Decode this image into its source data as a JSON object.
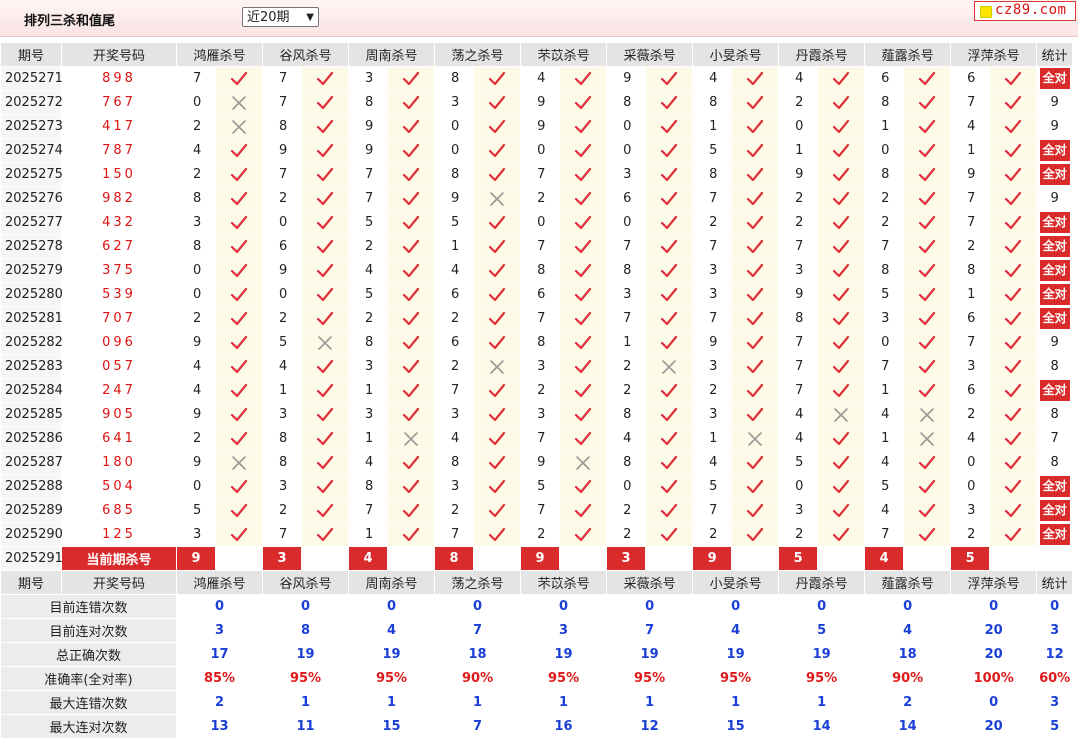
{
  "toolbar": {
    "title": "排列三杀和值尾",
    "period_select": "近20期",
    "logo_text": "cz89.com"
  },
  "colors": {
    "accent_red": "#d92b2b",
    "check_red": "#e0303a",
    "x_gray": "#999999",
    "stat_blue": "#1a3fd6"
  },
  "headers": {
    "period": "期号",
    "draw": "开奖号码",
    "experts": [
      "鸿雁杀号",
      "谷风杀号",
      "周南杀号",
      "荡之杀号",
      "芣苡杀号",
      "采薇杀号",
      "小旻杀号",
      "丹霞杀号",
      "薤露杀号",
      "浮萍杀号"
    ],
    "stat": "统计"
  },
  "rows": [
    {
      "period": "2025271",
      "draw": "898",
      "kills": [
        [
          7,
          1
        ],
        [
          7,
          1
        ],
        [
          3,
          1
        ],
        [
          8,
          1
        ],
        [
          4,
          1
        ],
        [
          9,
          1
        ],
        [
          4,
          1
        ],
        [
          4,
          1
        ],
        [
          6,
          1
        ],
        [
          6,
          1
        ]
      ],
      "stat": "全对"
    },
    {
      "period": "2025272",
      "draw": "767",
      "kills": [
        [
          0,
          0
        ],
        [
          7,
          1
        ],
        [
          8,
          1
        ],
        [
          3,
          1
        ],
        [
          9,
          1
        ],
        [
          8,
          1
        ],
        [
          8,
          1
        ],
        [
          2,
          1
        ],
        [
          8,
          1
        ],
        [
          7,
          1
        ]
      ],
      "stat": "9"
    },
    {
      "period": "2025273",
      "draw": "417",
      "kills": [
        [
          2,
          0
        ],
        [
          8,
          1
        ],
        [
          9,
          1
        ],
        [
          0,
          1
        ],
        [
          9,
          1
        ],
        [
          0,
          1
        ],
        [
          1,
          1
        ],
        [
          0,
          1
        ],
        [
          1,
          1
        ],
        [
          4,
          1
        ]
      ],
      "stat": "9"
    },
    {
      "period": "2025274",
      "draw": "787",
      "kills": [
        [
          4,
          1
        ],
        [
          9,
          1
        ],
        [
          9,
          1
        ],
        [
          0,
          1
        ],
        [
          0,
          1
        ],
        [
          0,
          1
        ],
        [
          5,
          1
        ],
        [
          1,
          1
        ],
        [
          0,
          1
        ],
        [
          1,
          1
        ]
      ],
      "stat": "全对"
    },
    {
      "period": "2025275",
      "draw": "150",
      "kills": [
        [
          2,
          1
        ],
        [
          7,
          1
        ],
        [
          7,
          1
        ],
        [
          8,
          1
        ],
        [
          7,
          1
        ],
        [
          3,
          1
        ],
        [
          8,
          1
        ],
        [
          9,
          1
        ],
        [
          8,
          1
        ],
        [
          9,
          1
        ]
      ],
      "stat": "全对"
    },
    {
      "period": "2025276",
      "draw": "982",
      "kills": [
        [
          8,
          1
        ],
        [
          2,
          1
        ],
        [
          7,
          1
        ],
        [
          9,
          0
        ],
        [
          2,
          1
        ],
        [
          6,
          1
        ],
        [
          7,
          1
        ],
        [
          2,
          1
        ],
        [
          2,
          1
        ],
        [
          7,
          1
        ]
      ],
      "stat": "9"
    },
    {
      "period": "2025277",
      "draw": "432",
      "kills": [
        [
          3,
          1
        ],
        [
          0,
          1
        ],
        [
          5,
          1
        ],
        [
          5,
          1
        ],
        [
          0,
          1
        ],
        [
          0,
          1
        ],
        [
          2,
          1
        ],
        [
          2,
          1
        ],
        [
          2,
          1
        ],
        [
          7,
          1
        ]
      ],
      "stat": "全对"
    },
    {
      "period": "2025278",
      "draw": "627",
      "kills": [
        [
          8,
          1
        ],
        [
          6,
          1
        ],
        [
          2,
          1
        ],
        [
          1,
          1
        ],
        [
          7,
          1
        ],
        [
          7,
          1
        ],
        [
          7,
          1
        ],
        [
          7,
          1
        ],
        [
          7,
          1
        ],
        [
          2,
          1
        ]
      ],
      "stat": "全对"
    },
    {
      "period": "2025279",
      "draw": "375",
      "kills": [
        [
          0,
          1
        ],
        [
          9,
          1
        ],
        [
          4,
          1
        ],
        [
          4,
          1
        ],
        [
          8,
          1
        ],
        [
          8,
          1
        ],
        [
          3,
          1
        ],
        [
          3,
          1
        ],
        [
          8,
          1
        ],
        [
          8,
          1
        ]
      ],
      "stat": "全对"
    },
    {
      "period": "2025280",
      "draw": "539",
      "kills": [
        [
          0,
          1
        ],
        [
          0,
          1
        ],
        [
          5,
          1
        ],
        [
          6,
          1
        ],
        [
          6,
          1
        ],
        [
          3,
          1
        ],
        [
          3,
          1
        ],
        [
          9,
          1
        ],
        [
          5,
          1
        ],
        [
          1,
          1
        ]
      ],
      "stat": "全对"
    },
    {
      "period": "2025281",
      "draw": "707",
      "kills": [
        [
          2,
          1
        ],
        [
          2,
          1
        ],
        [
          2,
          1
        ],
        [
          2,
          1
        ],
        [
          7,
          1
        ],
        [
          7,
          1
        ],
        [
          7,
          1
        ],
        [
          8,
          1
        ],
        [
          3,
          1
        ],
        [
          6,
          1
        ]
      ],
      "stat": "全对"
    },
    {
      "period": "2025282",
      "draw": "096",
      "kills": [
        [
          9,
          1
        ],
        [
          5,
          0
        ],
        [
          8,
          1
        ],
        [
          6,
          1
        ],
        [
          8,
          1
        ],
        [
          1,
          1
        ],
        [
          9,
          1
        ],
        [
          7,
          1
        ],
        [
          0,
          1
        ],
        [
          7,
          1
        ]
      ],
      "stat": "9"
    },
    {
      "period": "2025283",
      "draw": "057",
      "kills": [
        [
          4,
          1
        ],
        [
          4,
          1
        ],
        [
          3,
          1
        ],
        [
          2,
          0
        ],
        [
          3,
          1
        ],
        [
          2,
          0
        ],
        [
          3,
          1
        ],
        [
          7,
          1
        ],
        [
          7,
          1
        ],
        [
          3,
          1
        ]
      ],
      "stat": "8"
    },
    {
      "period": "2025284",
      "draw": "247",
      "kills": [
        [
          4,
          1
        ],
        [
          1,
          1
        ],
        [
          1,
          1
        ],
        [
          7,
          1
        ],
        [
          2,
          1
        ],
        [
          2,
          1
        ],
        [
          2,
          1
        ],
        [
          7,
          1
        ],
        [
          1,
          1
        ],
        [
          6,
          1
        ]
      ],
      "stat": "全对"
    },
    {
      "period": "2025285",
      "draw": "905",
      "kills": [
        [
          9,
          1
        ],
        [
          3,
          1
        ],
        [
          3,
          1
        ],
        [
          3,
          1
        ],
        [
          3,
          1
        ],
        [
          8,
          1
        ],
        [
          3,
          1
        ],
        [
          4,
          0
        ],
        [
          4,
          0
        ],
        [
          2,
          1
        ]
      ],
      "stat": "8"
    },
    {
      "period": "2025286",
      "draw": "641",
      "kills": [
        [
          2,
          1
        ],
        [
          8,
          1
        ],
        [
          1,
          0
        ],
        [
          4,
          1
        ],
        [
          7,
          1
        ],
        [
          4,
          1
        ],
        [
          1,
          0
        ],
        [
          4,
          1
        ],
        [
          1,
          0
        ],
        [
          4,
          1
        ]
      ],
      "stat": "7"
    },
    {
      "period": "2025287",
      "draw": "180",
      "kills": [
        [
          9,
          0
        ],
        [
          8,
          1
        ],
        [
          4,
          1
        ],
        [
          8,
          1
        ],
        [
          9,
          0
        ],
        [
          8,
          1
        ],
        [
          4,
          1
        ],
        [
          5,
          1
        ],
        [
          4,
          1
        ],
        [
          0,
          1
        ]
      ],
      "stat": "8"
    },
    {
      "period": "2025288",
      "draw": "504",
      "kills": [
        [
          0,
          1
        ],
        [
          3,
          1
        ],
        [
          8,
          1
        ],
        [
          3,
          1
        ],
        [
          5,
          1
        ],
        [
          0,
          1
        ],
        [
          5,
          1
        ],
        [
          0,
          1
        ],
        [
          5,
          1
        ],
        [
          0,
          1
        ]
      ],
      "stat": "全对"
    },
    {
      "period": "2025289",
      "draw": "685",
      "kills": [
        [
          5,
          1
        ],
        [
          2,
          1
        ],
        [
          7,
          1
        ],
        [
          2,
          1
        ],
        [
          7,
          1
        ],
        [
          2,
          1
        ],
        [
          7,
          1
        ],
        [
          3,
          1
        ],
        [
          4,
          1
        ],
        [
          3,
          1
        ]
      ],
      "stat": "全对"
    },
    {
      "period": "2025290",
      "draw": "125",
      "kills": [
        [
          3,
          1
        ],
        [
          7,
          1
        ],
        [
          1,
          1
        ],
        [
          7,
          1
        ],
        [
          2,
          1
        ],
        [
          2,
          1
        ],
        [
          2,
          1
        ],
        [
          2,
          1
        ],
        [
          7,
          1
        ],
        [
          2,
          1
        ]
      ],
      "stat": "全对"
    }
  ],
  "current": {
    "period": "2025291",
    "label": "当前期杀号",
    "kills": [
      "9",
      "3",
      "4",
      "8",
      "9",
      "3",
      "9",
      "5",
      "4",
      "5"
    ]
  },
  "stats": [
    {
      "label": "目前连错次数",
      "values": [
        "0",
        "0",
        "0",
        "0",
        "0",
        "0",
        "0",
        "0",
        "0",
        "0",
        "0"
      ]
    },
    {
      "label": "目前连对次数",
      "values": [
        "3",
        "8",
        "4",
        "7",
        "3",
        "7",
        "4",
        "5",
        "4",
        "20",
        "3"
      ]
    },
    {
      "label": "总正确次数",
      "values": [
        "17",
        "19",
        "19",
        "18",
        "19",
        "19",
        "19",
        "19",
        "18",
        "20",
        "12"
      ]
    },
    {
      "label": "准确率(全对率)",
      "values": [
        "85%",
        "95%",
        "95%",
        "90%",
        "95%",
        "95%",
        "95%",
        "95%",
        "90%",
        "100%",
        "60%"
      ]
    },
    {
      "label": "最大连错次数",
      "values": [
        "2",
        "1",
        "1",
        "1",
        "1",
        "1",
        "1",
        "1",
        "2",
        "0",
        "3"
      ]
    },
    {
      "label": "最大连对次数",
      "values": [
        "13",
        "11",
        "15",
        "7",
        "16",
        "12",
        "15",
        "14",
        "14",
        "20",
        "5"
      ]
    }
  ]
}
